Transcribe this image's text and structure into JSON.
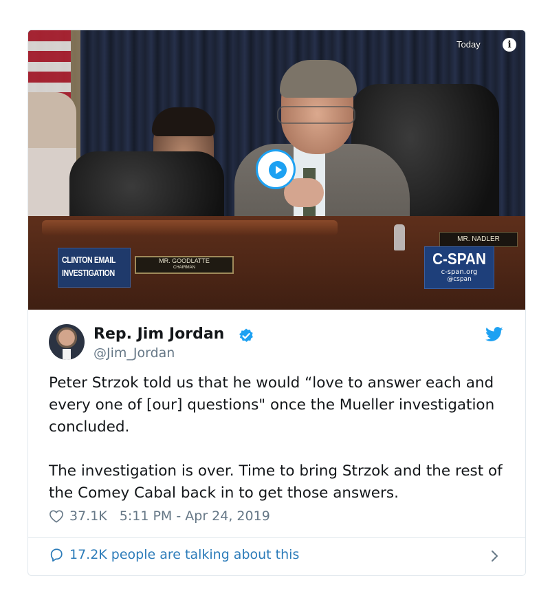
{
  "video": {
    "timestamp_label": "Today",
    "info_icon": "info-icon",
    "play_icon": "play-icon",
    "lower_third": {
      "line1": "CLINTON EMAIL",
      "line2": "INVESTIGATION"
    },
    "nameplate": {
      "name": "MR. GOODLATTE",
      "title": "CHAIRMAN"
    },
    "nameplate_right": "MR. NADLER",
    "network": {
      "logo": "C-SPAN",
      "site": "c-span.org",
      "handle": "@cspan"
    }
  },
  "tweet": {
    "author_name": "Rep. Jim Jordan",
    "verified_icon": "verified-badge-icon",
    "handle": "@Jim_Jordan",
    "brand_icon": "twitter-bird-icon",
    "paragraphs": [
      "Peter Strzok told us that he would “love to answer each and every one of [our] questions\" once the Mueller investigation concluded.",
      "The investigation is over. Time to bring Strzok and the rest of the Comey Cabal back in to get those answers."
    ],
    "likes": "37.1K",
    "timestamp": "5:11 PM - Apr 24, 2019",
    "talking": "17.2K people are talking about this"
  },
  "colors": {
    "twitter_blue": "#1da1f2",
    "link_blue": "#2b7bb9",
    "muted_gray": "#657786",
    "text_dark": "#14171a",
    "cspan_blue": "#1e3f7a"
  }
}
